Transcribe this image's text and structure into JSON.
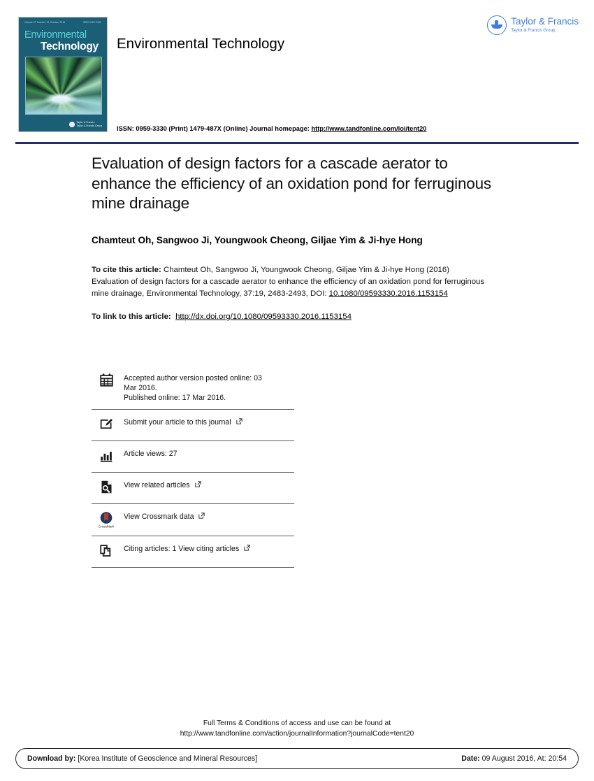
{
  "masthead": {
    "journal_title": "Environmental Technology",
    "issn_prefix": "ISSN: 0959-3330 (Print) 1479-487X (Online) Journal homepage:",
    "homepage_url": "http://www.tandfonline.com/loi/tent20",
    "cover": {
      "line_left": "Volume 37  Number 19  October 2016",
      "line_right": "ISSN 0959-3330",
      "title_line1": "Environmental",
      "title_line2": "Technology",
      "publisher_line1": "Taylor & Francis",
      "publisher_line2": "Taylor & Francis Group"
    },
    "publisher_logo": {
      "name": "Taylor & Francis",
      "group": "Taylor & Francis Group"
    },
    "rule_color": "#1f2f6e"
  },
  "article": {
    "title": "Evaluation of design factors for a cascade aerator to enhance the efficiency of an oxidation pond for ferruginous mine drainage",
    "authors": "Chamteut Oh, Sangwoo Ji, Youngwook Cheong, Giljae Yim & Ji-hye Hong",
    "cite_label": "To cite this article:",
    "cite_text": " Chamteut Oh, Sangwoo Ji, Youngwook Cheong, Giljae Yim & Ji-hye Hong (2016) Evaluation of design factors for a cascade aerator to enhance the efficiency of an oxidation pond for ferruginous mine drainage, Environmental Technology, 37:19, 2483-2493, DOI: ",
    "cite_doi": "10.1080/09593330.2016.1153154",
    "link_label": "To link to this article:",
    "link_url": "http://dx.doi.org/10.1080/09593330.2016.1153154"
  },
  "metadata": {
    "rows": [
      {
        "icon": "calendar-icon",
        "line1": "Accepted author version posted online: 03",
        "line2": "Mar 2016.",
        "line3": "Published online: 17 Mar 2016.",
        "external": false
      },
      {
        "icon": "pencil-submit-icon",
        "line1": "Submit your article to this journal",
        "external": true
      },
      {
        "icon": "bar-chart-icon",
        "line1": "Article views: 27",
        "external": false
      },
      {
        "icon": "related-articles-icon",
        "line1": "View related articles",
        "external": true
      },
      {
        "icon": "crossmark-icon",
        "line1": "View Crossmark data",
        "external": true
      },
      {
        "icon": "citing-articles-icon",
        "line1": "Citing articles: 1 View citing articles",
        "external": true
      }
    ]
  },
  "footer": {
    "terms_line1": "Full Terms & Conditions of access and use can be found at",
    "terms_line2": "http://www.tandfonline.com/action/journalInformation?journalCode=tent20",
    "download_label": "Download by:",
    "download_value": " [Korea Institute of Geoscience and Mineral Resources]",
    "date_label": "Date:",
    "date_value": " 09 August 2016, At: 20:54"
  }
}
